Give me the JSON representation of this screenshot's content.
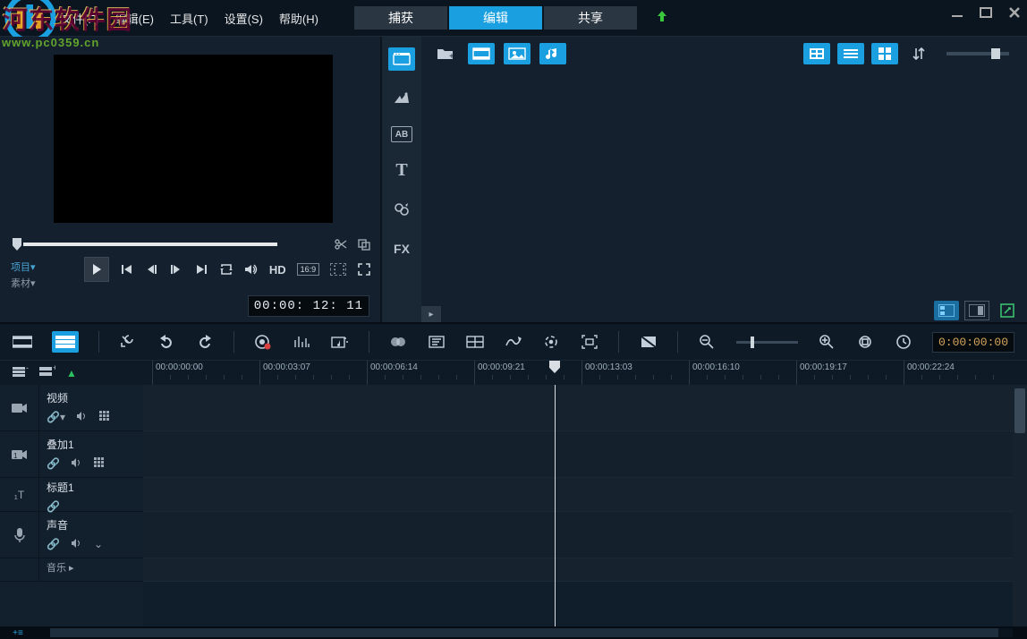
{
  "watermark": {
    "title": "河东软件园",
    "url": "www.pc0359.cn"
  },
  "menu": {
    "file": "文件(F)",
    "edit": "编辑(E)",
    "tools": "工具(T)",
    "settings": "设置(S)",
    "help": "帮助(H)"
  },
  "tabs": {
    "capture": "捕获",
    "edit": "编辑",
    "share": "共享"
  },
  "preview": {
    "label_project": "项目",
    "label_clip": "素材",
    "hd": "HD",
    "ratio": "16:9",
    "timecode": "00:00: 12: 11"
  },
  "library": {
    "rail": {
      "fx_label": "FX",
      "ab_label": "AB",
      "t_label": "T"
    }
  },
  "timeline": {
    "timecode": "0:00:00:00",
    "ruler": [
      "00:00:00:00",
      "00:00:03:07",
      "00:00:06:14",
      "00:00:09:21",
      "00:00:13:03",
      "00:00:16:10",
      "00:00:19:17",
      "00:00:22:24"
    ]
  },
  "tracks": {
    "video": "视频",
    "overlay1": "叠加1",
    "title1": "标题1",
    "voice": "声音",
    "music": "音乐"
  }
}
